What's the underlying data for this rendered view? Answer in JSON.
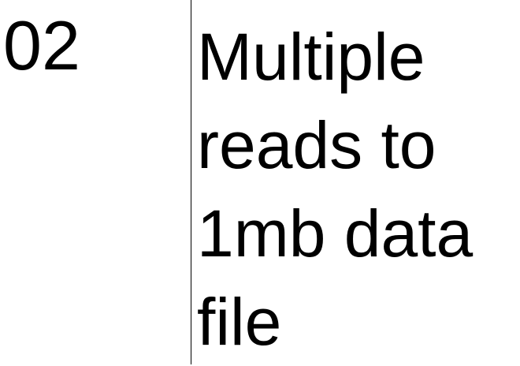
{
  "item": {
    "number": "02",
    "title_lines": [
      "Multiple",
      "reads to",
      "1mb data",
      "file"
    ]
  }
}
